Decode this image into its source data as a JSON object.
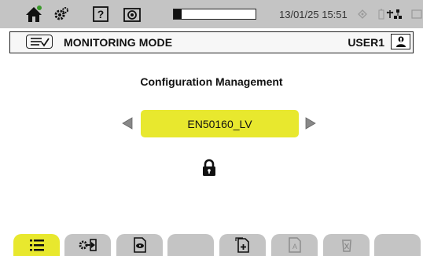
{
  "status_bar": {
    "icons": [
      "home-icon",
      "settings-gears-icon",
      "help-icon",
      "camera-icon"
    ],
    "progress_fraction": 0.1,
    "datetime": "13/01/25 15:51",
    "right_icons": [
      "gps-icon",
      "battery-icon",
      "usb-network-icon",
      "screen-icon"
    ]
  },
  "title_bar": {
    "mode_icon": "menu-check-icon",
    "title": "MONITORING MODE",
    "user_label": "USER1",
    "user_icon": "user-lock-icon"
  },
  "main": {
    "section_title": "Configuration Management",
    "selected_configuration": "EN50160_LV",
    "prev_icon": "left-arrow-icon",
    "next_icon": "right-arrow-icon",
    "lock_icon": "padlock-icon"
  },
  "tabs": [
    {
      "icon": "list-icon",
      "state": "active"
    },
    {
      "icon": "load-config-icon",
      "state": "normal"
    },
    {
      "icon": "view-document-icon",
      "state": "normal"
    },
    {
      "icon": "",
      "state": "empty"
    },
    {
      "icon": "new-document-icon",
      "state": "normal"
    },
    {
      "icon": "rename-document-icon",
      "state": "disabled"
    },
    {
      "icon": "delete-icon",
      "state": "disabled"
    },
    {
      "icon": "",
      "state": "empty"
    }
  ],
  "colors": {
    "accent_yellow": "#e8e82e",
    "bar_grey": "#c4c4c4",
    "status_green": "#3a9a2a",
    "status_red": "#d02020"
  }
}
